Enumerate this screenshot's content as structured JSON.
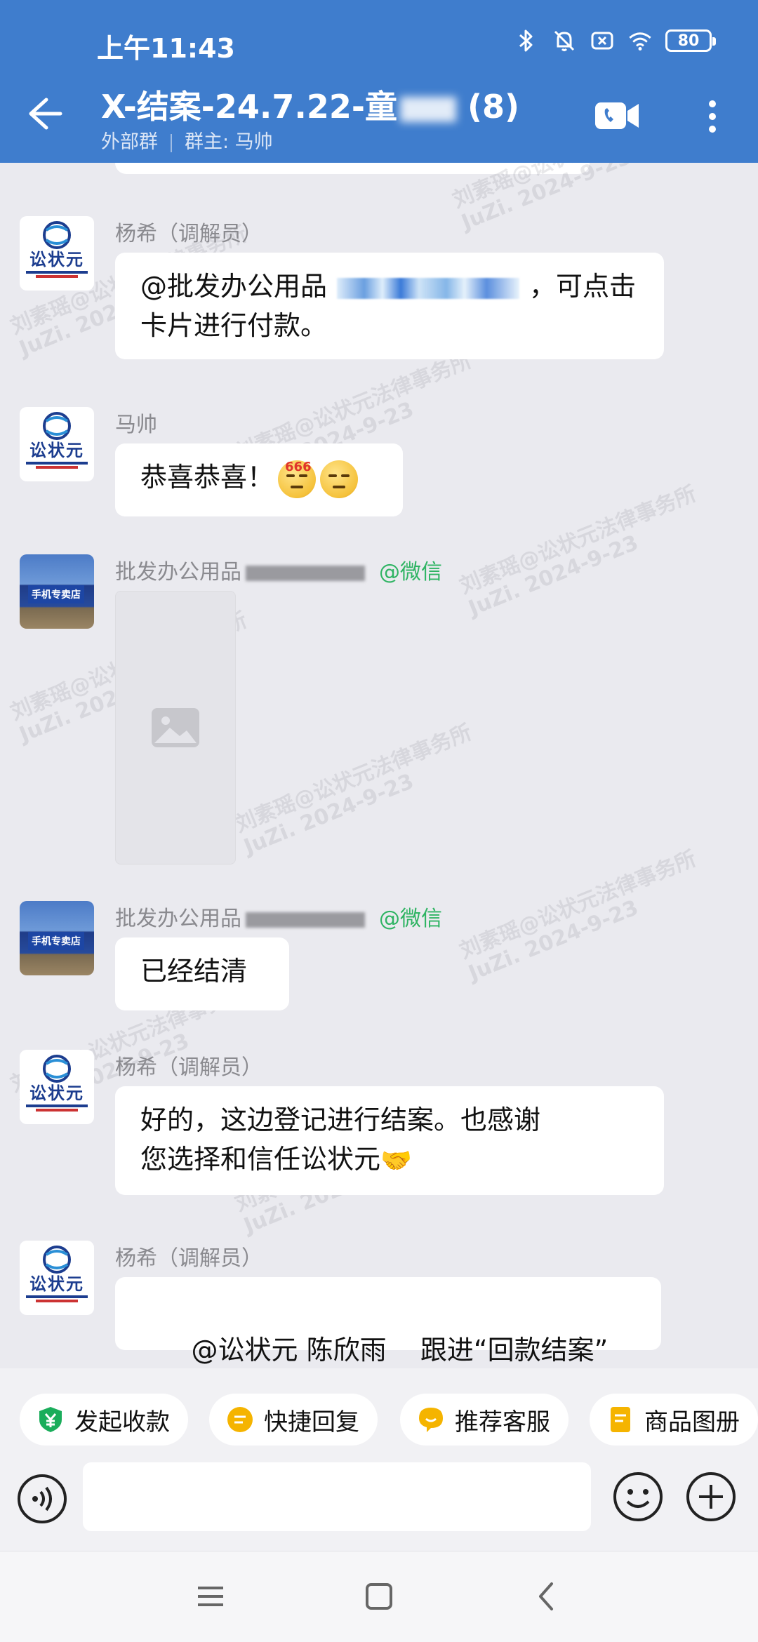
{
  "status_bar": {
    "time": "上午11:43",
    "battery": "80"
  },
  "header": {
    "title": "X-结案-24.7.22-童",
    "member_count": "(8)",
    "group_type": "外部群",
    "owner_label": "群主: 马帅"
  },
  "messages": [
    {
      "sender": "杨希（调解员）",
      "avatar": "logo",
      "text_before": "@批发办公用品",
      "text_after": "，可点击卡片进行付款。"
    },
    {
      "sender": "马帅",
      "avatar": "logo",
      "text": "恭喜恭喜！",
      "emoji_badge": "666"
    },
    {
      "sender": "批发办公用品",
      "sender_tag": "@微信",
      "avatar": "photo",
      "type": "image"
    },
    {
      "sender": "批发办公用品",
      "sender_tag": "@微信",
      "avatar": "photo",
      "text": "已经结清"
    },
    {
      "sender": "杨希（调解员）",
      "avatar": "logo",
      "text_line1": "好的，这边登记进行结案。也感谢",
      "text_line2": "您选择和信任讼状元"
    },
    {
      "sender": "杨希（调解员）",
      "avatar": "logo",
      "text": "@讼状元 陈欣雨    跟进“回款结案”"
    }
  ],
  "avatar_logo_text": "讼状元",
  "avatar_photo_text": "手机专卖店",
  "watermark": {
    "line1": "刘素瑶@讼状元法律事务所",
    "line2": "JuZi. 2024-9-23"
  },
  "quick_actions": [
    {
      "label": "发起收款",
      "icon": "payment-icon",
      "color": "#1aad5b"
    },
    {
      "label": "快捷回复",
      "icon": "quick-reply-icon",
      "color": "#f5b400"
    },
    {
      "label": "推荐客服",
      "icon": "service-icon",
      "color": "#f5b400"
    },
    {
      "label": "商品图册",
      "icon": "catalog-icon",
      "color": "#f5b400"
    }
  ],
  "colors": {
    "header_bg": "#3f7dcd",
    "chat_bg": "#eaeaef",
    "wechat_tag": "#2fb463"
  }
}
